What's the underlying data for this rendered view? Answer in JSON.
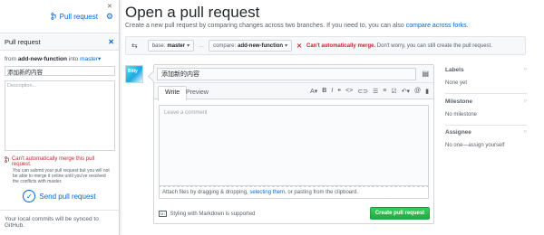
{
  "side_panel": {
    "top_label": "Pull request",
    "header_title": "Pull request",
    "from_prefix": "from",
    "from_branch": "add-new-function",
    "into_word": "into",
    "into_branch": "master",
    "title_value": "添加新的内容",
    "description_placeholder": "Description...",
    "warning_title": "Can't automatically merge this pull request.",
    "warning_detail": "You can submit your pull request but you will not be able to merge it online until you've resolved the conflicts with master.",
    "send_label": "Send pull request",
    "sync_note": "Your local commits will be synced to GitHub."
  },
  "main": {
    "title": "Open a pull request",
    "subtitle": "Create a new pull request by comparing changes across two branches. If you need to, you can also",
    "subtitle_link": "compare across forks.",
    "base_label": "base:",
    "base_value": "master",
    "compare_label": "compare:",
    "compare_value": "add-new-function",
    "merge_status": "Can't automatically merge.",
    "merge_note": "Don't worry, you can still create the pull request.",
    "avatar_text": "Bitly"
  },
  "form": {
    "title_value": "添加新的内容",
    "tab_write": "Write",
    "tab_preview": "Preview",
    "comment_placeholder": "Leave a comment",
    "attach_prefix": "Attach files by dragging & dropping,",
    "attach_link": "selecting them",
    "attach_suffix": ", or pasting from the clipboard.",
    "markdown_note": "Styling with Markdown is supported",
    "create_button": "Create pull request"
  },
  "sidebar": {
    "labels_title": "Labels",
    "labels_value": "None yet",
    "milestone_title": "Milestone",
    "milestone_value": "No milestone",
    "assignee_title": "Assignee",
    "assignee_value": "No one—assign yourself"
  },
  "icons": [
    "pull-request-icon",
    "gear-icon",
    "close-icon",
    "swap-icon",
    "x-icon",
    "markdown-icon",
    "document-icon",
    "check-icon"
  ],
  "colors": {
    "link": "#0366d6",
    "error": "#cb2431",
    "button_green": "#28a745"
  }
}
